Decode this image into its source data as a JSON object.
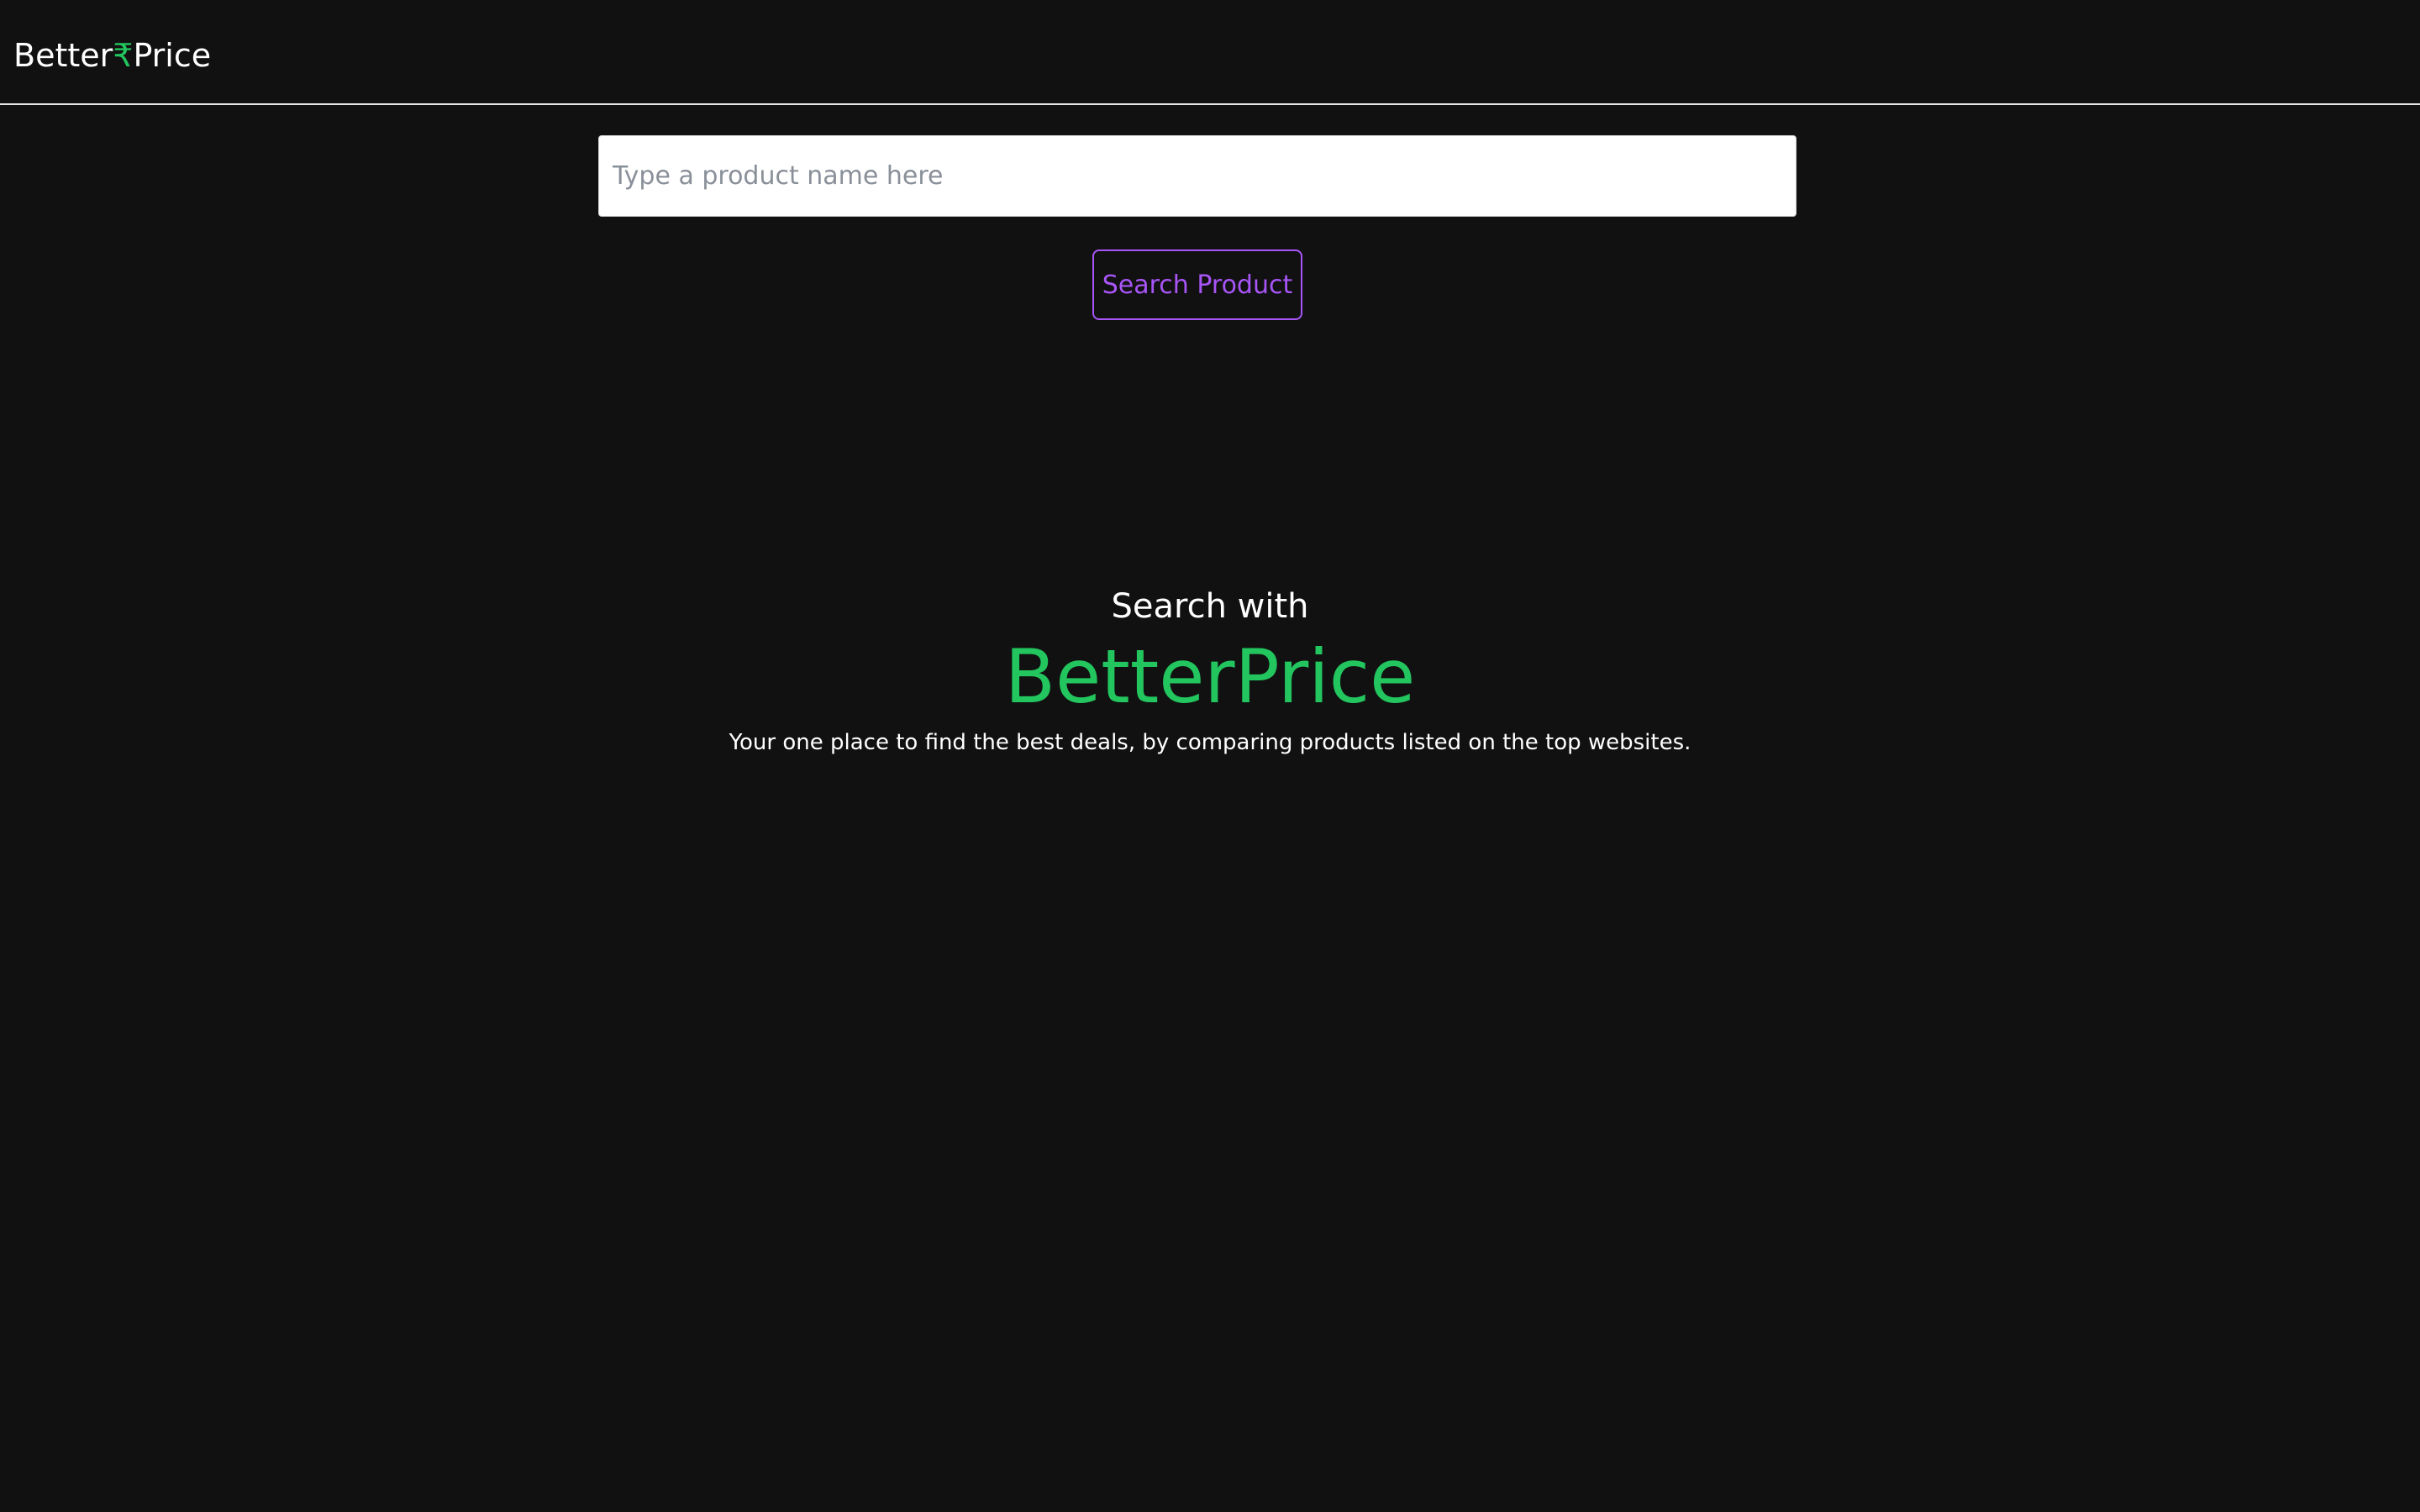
{
  "navbar": {
    "brand_prefix": "Better",
    "brand_symbol": "₹",
    "brand_suffix": "Price"
  },
  "search": {
    "placeholder": "Type a product name here",
    "value": "",
    "button_label": "Search Product"
  },
  "hero": {
    "kicker": "Search with",
    "title": "BetterPrice",
    "tagline": "Your one place to find the best deals, by comparing products listed on the top websites."
  },
  "colors": {
    "background": "#111111",
    "accent_green": "#22c55e",
    "accent_purple": "#a855f7",
    "text": "#ffffff"
  }
}
